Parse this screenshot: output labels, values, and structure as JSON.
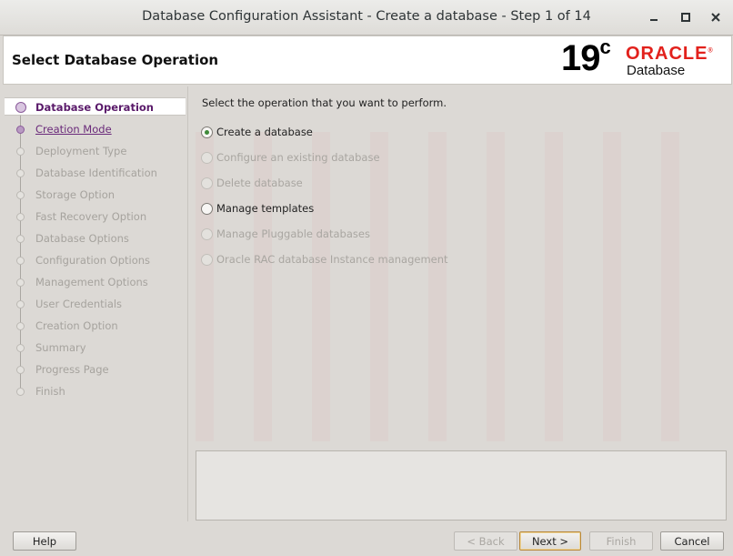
{
  "window": {
    "title": "Database Configuration Assistant - Create a database - Step 1 of 14",
    "minimize_icon": "minimize-icon",
    "maximize_icon": "maximize-icon",
    "close_icon": "close-icon"
  },
  "header": {
    "title": "Select Database Operation",
    "logo": {
      "version": "19",
      "version_sup": "c",
      "brand": "ORACLE",
      "brand_mark": "®",
      "product": "Database"
    }
  },
  "nav": {
    "items": [
      {
        "label": "Database Operation",
        "state": "active"
      },
      {
        "label": "Creation Mode",
        "state": "link"
      },
      {
        "label": "Deployment Type",
        "state": "disabled"
      },
      {
        "label": "Database Identification",
        "state": "disabled"
      },
      {
        "label": "Storage Option",
        "state": "disabled"
      },
      {
        "label": "Fast Recovery Option",
        "state": "disabled"
      },
      {
        "label": "Database Options",
        "state": "disabled"
      },
      {
        "label": "Configuration Options",
        "state": "disabled"
      },
      {
        "label": "Management Options",
        "state": "disabled"
      },
      {
        "label": "User Credentials",
        "state": "disabled"
      },
      {
        "label": "Creation Option",
        "state": "disabled"
      },
      {
        "label": "Summary",
        "state": "disabled"
      },
      {
        "label": "Progress Page",
        "state": "disabled"
      },
      {
        "label": "Finish",
        "state": "disabled"
      }
    ]
  },
  "main": {
    "prompt": "Select the operation that you want to perform.",
    "options": [
      {
        "label": "Create a database",
        "checked": true,
        "enabled": true
      },
      {
        "label": "Configure an existing database",
        "checked": false,
        "enabled": false
      },
      {
        "label": "Delete database",
        "checked": false,
        "enabled": false
      },
      {
        "label": "Manage templates",
        "checked": false,
        "enabled": true
      },
      {
        "label": "Manage Pluggable databases",
        "checked": false,
        "enabled": false
      },
      {
        "label": "Oracle RAC database Instance management",
        "checked": false,
        "enabled": false
      }
    ],
    "message": ""
  },
  "buttons": {
    "help": "Help",
    "back": "< Back",
    "next": "Next >",
    "finish": "Finish",
    "cancel": "Cancel"
  },
  "colors": {
    "accent": "#5a1a6a",
    "oracle_red": "#e2211c",
    "radio_selected": "#3f8a3a"
  }
}
